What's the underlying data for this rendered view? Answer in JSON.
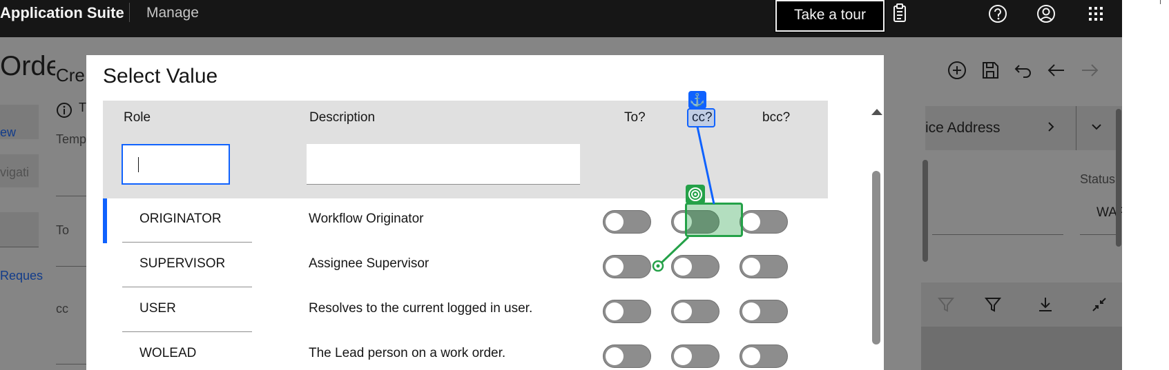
{
  "topbar": {
    "app_title": "Application Suite",
    "manage_label": "Manage",
    "tour_label": "Take a tour",
    "icons": [
      "clipboard-icon",
      "help-icon",
      "user-avatar-icon",
      "app-switcher-icon"
    ]
  },
  "background": {
    "page_title_fragment": "Orde",
    "form_title_fragment": "Cre",
    "info_fragment": "T",
    "template_label_fragment": "Temp",
    "link_fragment_1": "ew",
    "nav_fragment": "vigati",
    "to_label": "To",
    "request_link_fragment": "Reques",
    "cc_label": "cc",
    "service_address_fragment": "ice Address",
    "status_label": "Status",
    "status_value_fragment": "WAP",
    "toolbar_icons": [
      "add-icon",
      "save-icon",
      "undo-icon",
      "back-arrow-icon",
      "forward-arrow-icon"
    ],
    "table_tool_icons": [
      "clear-filter-icon",
      "filter-icon",
      "download-icon",
      "collapse-icon"
    ]
  },
  "modal": {
    "title": "Select Value",
    "columns": {
      "role": "Role",
      "description": "Description",
      "to": "To?",
      "cc": "cc?",
      "bcc": "bcc?"
    },
    "filters": {
      "role_value": "",
      "description_value": ""
    },
    "rows": [
      {
        "role": "ORIGINATOR",
        "description": "Workflow Originator",
        "to": false,
        "cc": false,
        "bcc": false
      },
      {
        "role": "SUPERVISOR",
        "description": "Assignee Supervisor",
        "to": false,
        "cc": false,
        "bcc": false
      },
      {
        "role": "USER",
        "description": "Resolves to the current logged in user.",
        "to": false,
        "cc": false,
        "bcc": false
      },
      {
        "role": "WOLEAD",
        "description": "The Lead person on a work order.",
        "to": false,
        "cc": false,
        "bcc": false
      }
    ]
  },
  "annotation": {
    "anchor_glyph": "⚓",
    "anchor_color": "#0f62fe",
    "target_color": "#24a148"
  }
}
